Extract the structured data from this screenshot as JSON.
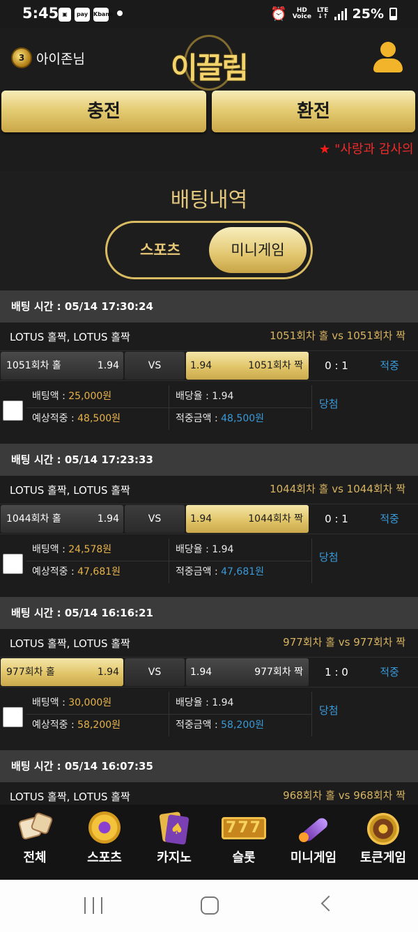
{
  "status_bar": {
    "time": "5:45",
    "icons": [
      "gallery-icon",
      "pay-icon",
      "kbank-icon"
    ],
    "pay_label": "pay",
    "kbank_label": "Kbank",
    "hd": "HD",
    "voice": "Voice",
    "lte": "LTE",
    "battery": "25%"
  },
  "header": {
    "user_name": "아이존님",
    "level_badge": "3",
    "logo_text": "이끌림",
    "charge_label": "충전",
    "exchange_label": "환전",
    "notice": "\"사랑과 감사의"
  },
  "page": {
    "title": "배팅내역",
    "tabs": [
      {
        "label": "스포츠",
        "active": false
      },
      {
        "label": "미니게임",
        "active": true
      }
    ]
  },
  "bets": [
    {
      "time": "배팅 시간 : 05/14 17:30:24",
      "game": "LOTUS 홀짝, LOTUS 홀짝",
      "matchup": "1051회차 홀  vs  1051회차 짝",
      "home_team": "1051회차 홀",
      "home_odd": "1.94",
      "vs": "VS",
      "away_odd": "1.94",
      "away_team": "1051회차 짝",
      "selected": "away",
      "score": "0 : 1",
      "result": "적중",
      "bet_amount_label": "배팅액 : ",
      "bet_amount": "25,000원",
      "odds_label": "배당율 : ",
      "odds": "1.94",
      "expected_label": "예상적중 : ",
      "expected": "48,500원",
      "win_amount_label": "적중금액 : ",
      "win_amount": "48,500원",
      "status": "당첨"
    },
    {
      "time": "배팅 시간 : 05/14 17:23:33",
      "game": "LOTUS 홀짝, LOTUS 홀짝",
      "matchup": "1044회차 홀  vs  1044회차 짝",
      "home_team": "1044회차 홀",
      "home_odd": "1.94",
      "vs": "VS",
      "away_odd": "1.94",
      "away_team": "1044회차 짝",
      "selected": "away",
      "score": "0 : 1",
      "result": "적중",
      "bet_amount_label": "배팅액 : ",
      "bet_amount": "24,578원",
      "odds_label": "배당율 : ",
      "odds": "1.94",
      "expected_label": "예상적중 : ",
      "expected": "47,681원",
      "win_amount_label": "적중금액 : ",
      "win_amount": "47,681원",
      "status": "당첨"
    },
    {
      "time": "배팅 시간 : 05/14 16:16:21",
      "game": "LOTUS 홀짝, LOTUS 홀짝",
      "matchup": "977회차 홀  vs  977회차 짝",
      "home_team": "977회차 홀",
      "home_odd": "1.94",
      "vs": "VS",
      "away_odd": "1.94",
      "away_team": "977회차 짝",
      "selected": "home",
      "score": "1 : 0",
      "result": "적중",
      "bet_amount_label": "배팅액 : ",
      "bet_amount": "30,000원",
      "odds_label": "배당율 : ",
      "odds": "1.94",
      "expected_label": "예상적중 : ",
      "expected": "58,200원",
      "win_amount_label": "적중금액 : ",
      "win_amount": "58,200원",
      "status": "당첨"
    },
    {
      "time": "배팅 시간 : 05/14 16:07:35",
      "game": "LOTUS 홀짝, LOTUS 홀짝",
      "matchup": "968회차 홀  vs  968회차 짝"
    }
  ],
  "bottom_nav": [
    {
      "label": "전체",
      "icon": "dice-icon"
    },
    {
      "label": "스포츠",
      "icon": "soccer-ball-icon"
    },
    {
      "label": "카지노",
      "icon": "cards-icon"
    },
    {
      "label": "슬롯",
      "icon": "slot-777-icon"
    },
    {
      "label": "미니게임",
      "icon": "rocket-icon"
    },
    {
      "label": "토큰게임",
      "icon": "roulette-icon"
    }
  ],
  "slot_text": "777",
  "colors": {
    "gold": "#e3c67d",
    "accent_blue": "#3a9ad9",
    "amount_gold": "#e6b34a",
    "notice_red": "#ee2b2b",
    "background": "#1e1e1e"
  }
}
